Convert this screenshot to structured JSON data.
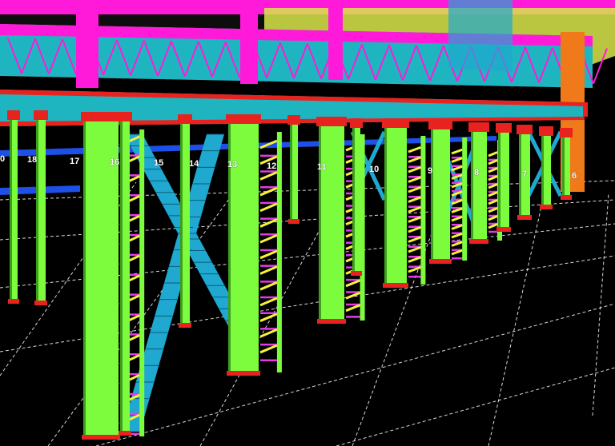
{
  "viewer": {
    "background": "#000000",
    "palette": {
      "column": "#7CFC3C",
      "girder": "#1FB5C0",
      "truss_top": "#FF1AD9",
      "ladder_rail": "#F6F23A",
      "ladder_rung": "#E23CE8",
      "cross_brace": "#1FA8D0",
      "blue_beam": "#1E4FE6",
      "red_plate": "#E8231F",
      "orange_member": "#F07A1A",
      "grid_line": "#FFFFFF"
    }
  },
  "grid_labels": [
    "0",
    "18",
    "17",
    "16",
    "15",
    "14",
    "13",
    "12",
    "11",
    "10",
    "9",
    "8",
    "7",
    "6"
  ]
}
